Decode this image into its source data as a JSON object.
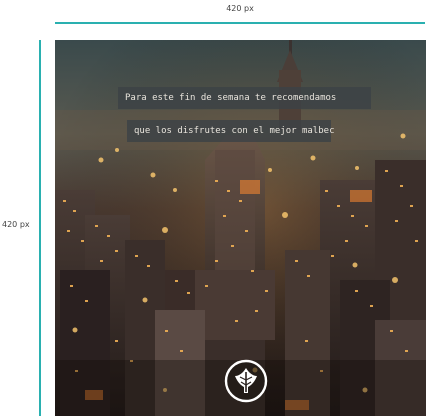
{
  "dimensions": {
    "width_label": "420 px",
    "height_label": "420 px"
  },
  "photo": {
    "subject": "night-city-skyline",
    "caption_line_1": "Para este fin de semana te recomendamos",
    "caption_line_2": "que los disfrutes con el mejor malbec"
  },
  "logo": {
    "icon": "leaf-emblem-icon"
  },
  "colors": {
    "guide_line": "#2ab0b0",
    "caption_bg": "#3c4246",
    "caption_text": "#e8e4dc",
    "logo_stroke": "#ffffff"
  }
}
